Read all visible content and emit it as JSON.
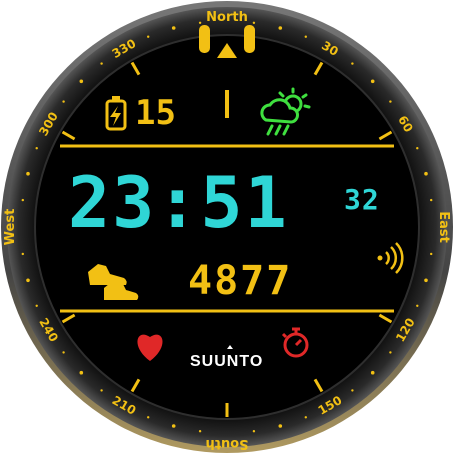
{
  "bezel": {
    "north": "North",
    "south": "South",
    "east": "East",
    "west": "West",
    "degrees": [
      "30",
      "60",
      "120",
      "150",
      "210",
      "240",
      "300",
      "330"
    ]
  },
  "status": {
    "battery_value": "15",
    "weather_icon": "cloud-sun-rain-icon"
  },
  "time": {
    "hours_minutes": "23:51",
    "seconds": "32"
  },
  "activity": {
    "steps": "4877",
    "steps_icon": "shoes-icon",
    "signal_icon": "signal-waves-icon"
  },
  "bottom": {
    "heart_icon": "heart-icon",
    "brand": "SUUNTO",
    "stopwatch_icon": "stopwatch-icon"
  },
  "colors": {
    "accent": "#f2c014",
    "time": "#2fd6d6",
    "weather": "#3fe03f",
    "alert": "#e02828",
    "bezel": "#151515",
    "face": "#000000"
  }
}
